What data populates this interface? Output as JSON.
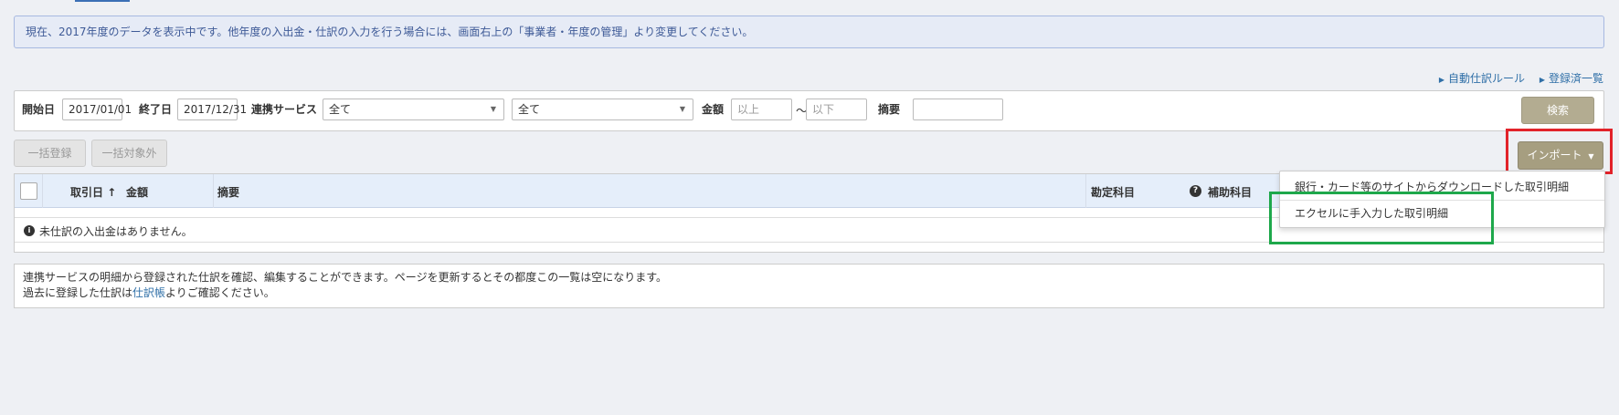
{
  "notice": "現在、2017年度のデータを表示中です。他年度の入出金・仕訳の入力を行う場合には、画面右上の「事業者・年度の管理」より変更してください。",
  "links": {
    "auto_rule": "自動仕訳ルール",
    "registered_list": "登録済一覧"
  },
  "filter": {
    "start_label": "開始日",
    "start_value": "2017/01/01",
    "end_label": "終了日",
    "end_value": "2017/12/31",
    "service_label": "連携サービス",
    "service_select_1": "全て",
    "service_select_2": "全て",
    "amount_label": "金額",
    "amount_min_placeholder": "以上",
    "amount_tilde": "〜",
    "amount_max_placeholder": "以下",
    "summary_label": "摘要",
    "summary_value": "",
    "search_button": "検索"
  },
  "actions": {
    "bulk_register": "一括登録",
    "bulk_exclude": "一括対象外",
    "import_button": "インポート"
  },
  "table": {
    "headers": {
      "date": "取引日",
      "amount": "金額",
      "summary": "摘要",
      "account": "勘定科目",
      "sub_account": "補助科目"
    },
    "empty_message": "未仕訳の入出金はありません。"
  },
  "import_menu": {
    "items": [
      "銀行・カード等のサイトからダウンロードした取引明細",
      "エクセルに手入力した取引明細"
    ]
  },
  "footer": {
    "line1": "連携サービスの明細から登録された仕訳を確認、編集することができます。ページを更新するとその都度この一覧は空になります。",
    "line2_prefix": "過去に登録した仕訳は",
    "line2_link": "仕訳帳",
    "line2_suffix": "よりご確認ください。"
  },
  "colors": {
    "accent": "#3b6fb5",
    "import_button": "#a69e80",
    "highlight_red": "#e2232a",
    "highlight_green": "#1ea84b"
  }
}
